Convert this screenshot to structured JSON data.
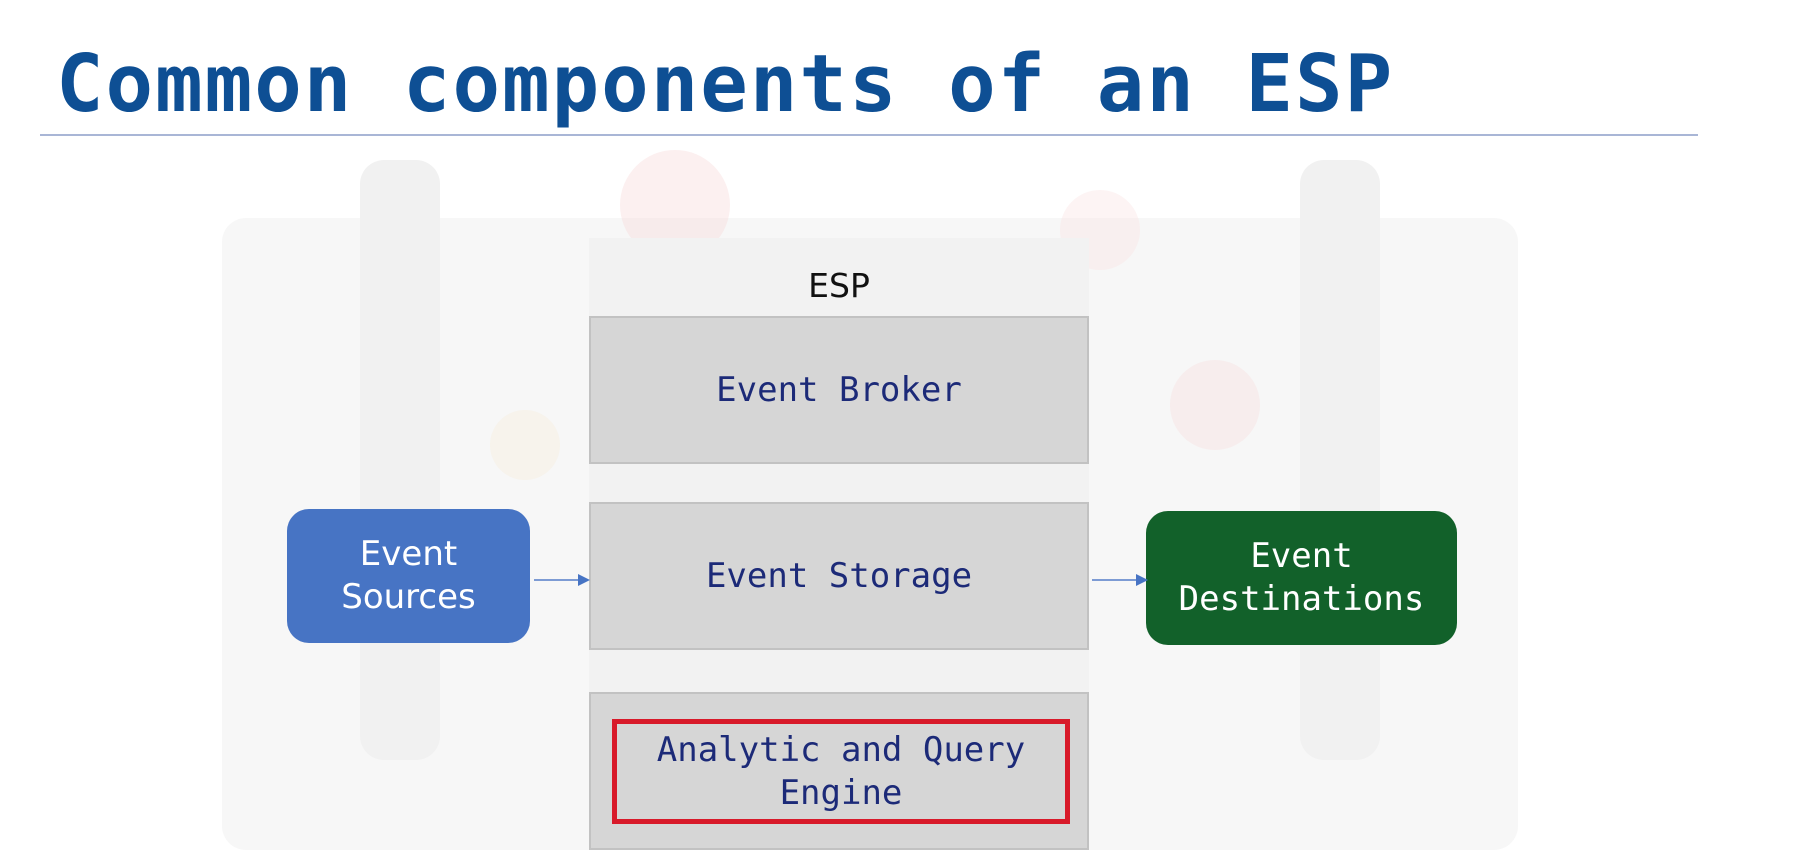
{
  "slide": {
    "title": "Common components of an ESP"
  },
  "diagram": {
    "esp_label": "ESP",
    "broker": "Event Broker",
    "storage": "Event Storage",
    "engine": "Analytic and Query\nEngine",
    "sources": "Event\nSources",
    "destinations": "Event\nDestinations"
  },
  "colors": {
    "title": "#0e4f94",
    "sources_fill": "#4774c4",
    "destinations_fill": "#12612a",
    "component_fill": "#d6d6d6",
    "highlight_border": "#d81a2a",
    "component_text": "#1c2a78"
  }
}
